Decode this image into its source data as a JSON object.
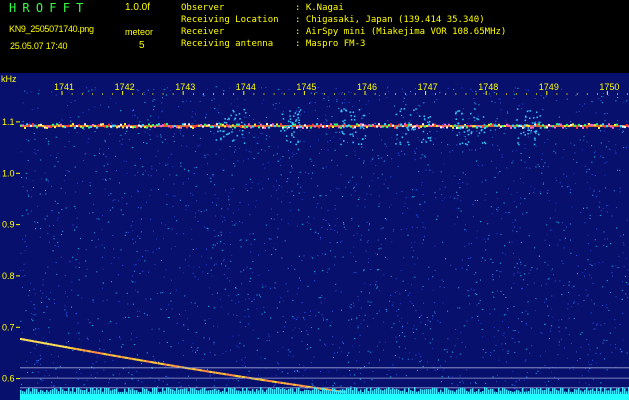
{
  "header": {
    "brand": "HROFFT",
    "version": "1.0.0f",
    "filename": "KN9_2505071740.png",
    "meteor_label": "meteor",
    "datetime": "25.05.07 17:40",
    "meteor_count": "5",
    "info": [
      {
        "key": "Observer",
        "value": ": K.Nagai"
      },
      {
        "key": "Receiving Location",
        "value": ": Chigasaki, Japan (139.414 35.340)"
      },
      {
        "key": "Receiver",
        "value": ": AirSpy mini (Miakejima VOR 108.65MHz)"
      },
      {
        "key": "Receiving antenna",
        "value": ": Maspro FM-3"
      }
    ]
  },
  "spectrogram": {
    "y_unit": "kHz",
    "y_ticks": [
      "1.1",
      "1.0",
      "0.9",
      "0.8",
      "0.7",
      "0.6"
    ],
    "y_range_khz": [
      0.57,
      1.17
    ],
    "x_ticks": [
      "1741",
      "1742",
      "1743",
      "1744",
      "1745",
      "1746",
      "1747",
      "1748",
      "1749",
      "1750"
    ],
    "colors": {
      "background": "#08106e",
      "tick_label": "#ffff00",
      "carrier": "#ff7722",
      "noise_floor": "#22ffff"
    },
    "carrier_khz": 1.092,
    "reference_lines_khz": [
      0.621,
      0.601,
      0.582
    ]
  }
}
